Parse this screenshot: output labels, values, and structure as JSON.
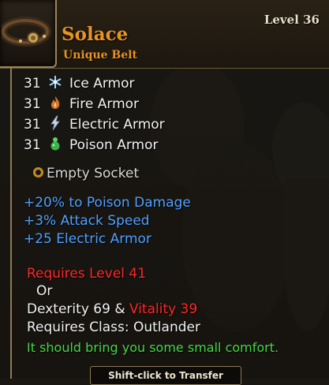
{
  "colors": {
    "item_name": "#e89420",
    "magic_mod": "#4fa0ff",
    "requirement_unmet": "#ff2727",
    "flavor": "#46d646",
    "frame_gold": "#9c8657"
  },
  "header": {
    "level": "Level 36",
    "item_name": "Solace",
    "item_type": "Unique Belt",
    "icon": "belt-icon"
  },
  "armor": [
    {
      "value": "31",
      "label": "Ice Armor",
      "icon": "ice-armor-icon"
    },
    {
      "value": "31",
      "label": "Fire Armor",
      "icon": "fire-armor-icon"
    },
    {
      "value": "31",
      "label": "Electric Armor",
      "icon": "electric-armor-icon"
    },
    {
      "value": "31",
      "label": "Poison Armor",
      "icon": "poison-armor-icon"
    }
  ],
  "socket": {
    "label": "Empty Socket",
    "icon": "socket-ring-icon"
  },
  "mods": [
    "+20% to Poison Damage",
    "+3% Attack Speed",
    "+25 Electric Armor"
  ],
  "requirements": {
    "level": "Requires Level 41",
    "or": "Or",
    "dexterity": "Dexterity 69",
    "ampersand": "&",
    "vitality": "Vitality 39",
    "class": "Requires Class: Outlander"
  },
  "flavor_text": "It should bring you some small comfort.",
  "transfer_hint": "Shift-click to Transfer"
}
